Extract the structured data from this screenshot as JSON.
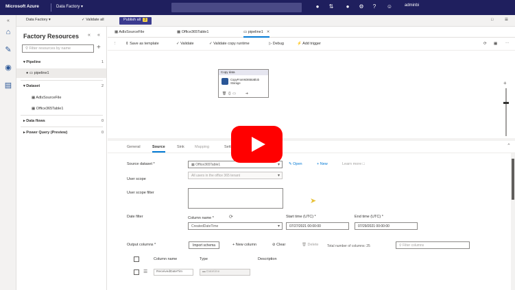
{
  "topbar": {
    "brand": "Microsoft Azure",
    "crumb": "Data Factory",
    "search_placeholder": "",
    "user": "adminbi",
    "colors": {
      "bar": "#1f1f5e"
    }
  },
  "bar2": {
    "factory": "Data Factory",
    "validate_all": "Validate all",
    "publish_all": "Publish all",
    "publish_count": "3"
  },
  "rail": {
    "icons": [
      "home-icon",
      "author-pencil-icon",
      "monitor-icon",
      "manage-toolbox-icon"
    ]
  },
  "panel": {
    "title": "Factory Resources",
    "filter_placeholder": "Filter resources by name",
    "tree": [
      {
        "label": "Pipeline",
        "count": "1"
      },
      {
        "label": "pipeline1",
        "count": ""
      },
      {
        "label": "Dataset",
        "count": "2"
      },
      {
        "label": "AdlsSourceFile",
        "count": ""
      },
      {
        "label": "Office365Table1",
        "count": ""
      },
      {
        "label": "Data flows",
        "count": "0"
      },
      {
        "label": "Power Query (Preview)",
        "count": "0"
      }
    ]
  },
  "tabs": [
    {
      "label": "AdlsSourceFile"
    },
    {
      "label": "Office365Table1"
    },
    {
      "label": "pipeline1"
    }
  ],
  "toolbar": {
    "save_as_template": "Save as template",
    "validate": "Validate",
    "validate_copy_runtime": "Validate copy runtime",
    "debug": "Debug",
    "add_trigger": "Add trigger"
  },
  "activity": {
    "header": "Copy data",
    "name": "CopyFromM365toBlob Storage"
  },
  "prop_tabs": [
    {
      "label": "General"
    },
    {
      "label": "Source"
    },
    {
      "label": "Sink"
    },
    {
      "label": "Mapping"
    },
    {
      "label": "Settings"
    }
  ],
  "form": {
    "source_dataset_label": "Source dataset *",
    "source_dataset_value": "Office365Table1",
    "open": "Open",
    "new": "New",
    "learn_more": "Learn more",
    "user_scope_label": "User scope",
    "user_scope_value": "All users in the office 365 tenant",
    "user_scope_filter_label": "User scope filter",
    "date_filter_label": "Date filter",
    "column_name_label": "Column name *",
    "column_name_value": "CreatedDateTime",
    "start_time_label": "Start time (UTC) *",
    "start_time_value": "07/27/2021 00:00:00",
    "end_time_label": "End time (UTC) *",
    "end_time_value": "07/29/2021 00:00:00",
    "output_columns_label": "Output columns *",
    "import_schema": "Import schema",
    "new_column": "New column",
    "clear": "Clear",
    "delete": "Delete",
    "total_columns": "Total number of columns: 25",
    "filter_columns_placeholder": "Filter columns",
    "col_header_name": "Column name",
    "col_header_type": "Type",
    "col_header_desc": "Description",
    "row1_name": "ReceivedDateTim",
    "row1_type": "Datetime"
  }
}
